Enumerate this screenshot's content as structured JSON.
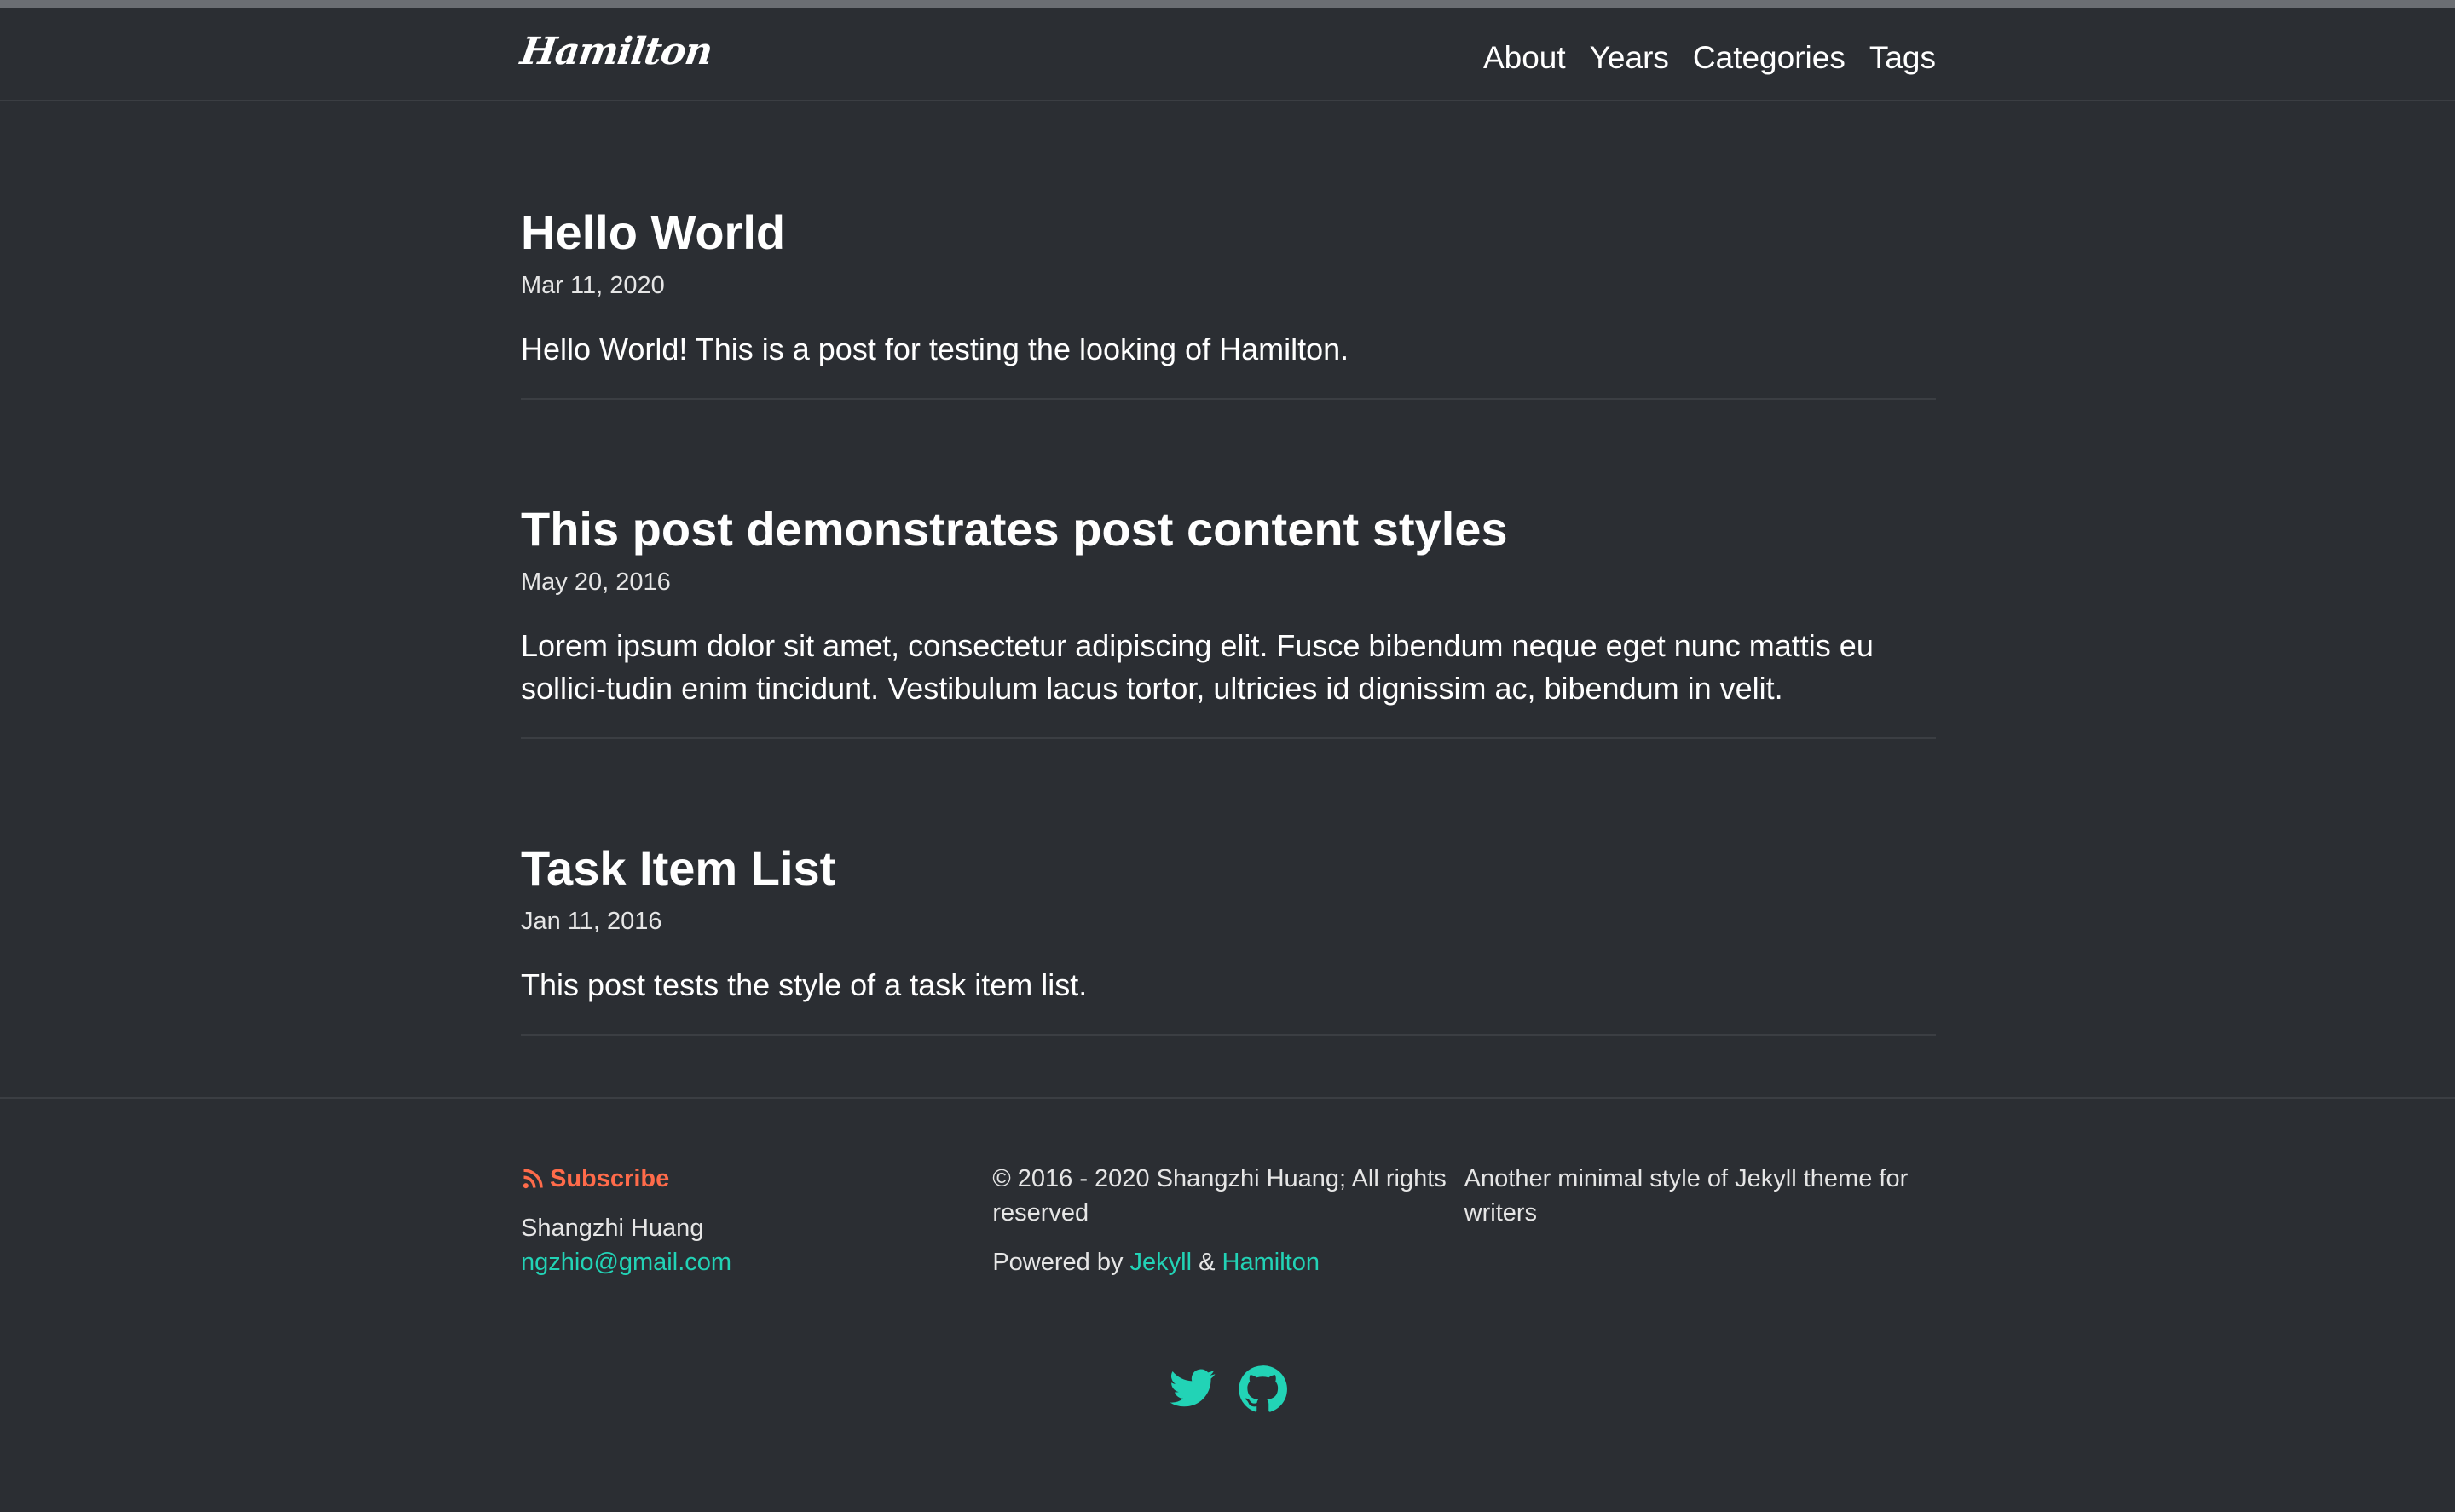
{
  "site": {
    "logo": "Hamilton"
  },
  "nav": {
    "items": [
      "About",
      "Years",
      "Categories",
      "Tags"
    ]
  },
  "posts": [
    {
      "title": "Hello World",
      "date": "Mar 11, 2020",
      "excerpt": "Hello World! This is a post for testing the looking of Hamilton."
    },
    {
      "title": "This post demonstrates post content styles",
      "date": "May 20, 2016",
      "excerpt": "Lorem ipsum dolor sit amet, consectetur adipiscing elit. Fusce bibendum neque eget nunc mattis eu sollici-tudin enim tincidunt. Vestibulum lacus tortor, ultricies id dignissim ac, bibendum in velit."
    },
    {
      "title": "Task Item List",
      "date": "Jan 11, 2016",
      "excerpt": "This post tests the style of a task item list."
    }
  ],
  "footer": {
    "subscribe": "Subscribe",
    "author": "Shangzhi Huang",
    "email": "ngzhio@gmail.com",
    "copyright": "© 2016 - 2020 Shangzhi Huang; All rights reserved",
    "powered_prefix": "Powered by",
    "jekyll": "Jekyll",
    "amp": "&",
    "hamilton": "Hamilton",
    "description": "Another minimal style of Jekyll theme for writers"
  },
  "social": {
    "icons": [
      "twitter-icon",
      "github-icon"
    ]
  },
  "colors": {
    "background": "#2b2e33",
    "accent": "#22d3b6",
    "rss": "#ff6b4a"
  }
}
